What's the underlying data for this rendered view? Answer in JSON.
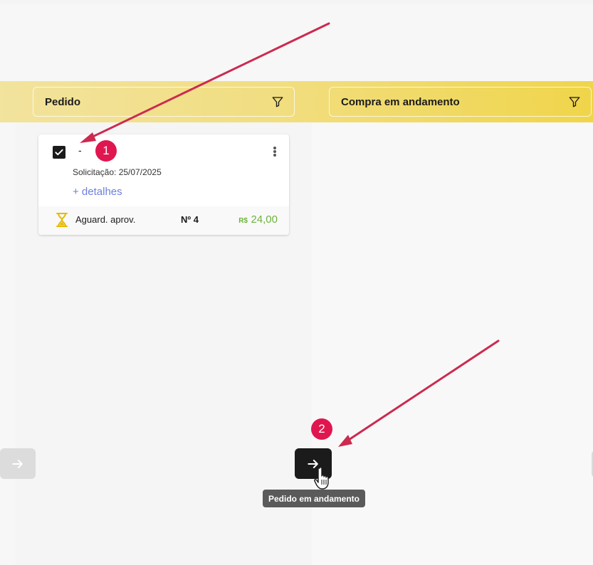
{
  "columns": [
    {
      "title": "Pedido",
      "icon": "filter-icon"
    },
    {
      "title": "Compra em andamento",
      "icon": "filter-icon"
    }
  ],
  "card": {
    "name": "-",
    "checked": true,
    "date": "Solicitação: 25/07/2025",
    "details_link": "+ detalhes",
    "status": "Aguard. aprov.",
    "status_icon": "hourglass-icon",
    "number": "Nº 4",
    "currency": "R$",
    "amount": "24,00"
  },
  "annotations": {
    "step1": "1",
    "step2": "2"
  },
  "navigation": {
    "prev_icon": "arrow-right-icon",
    "next_icon": "arrow-right-icon",
    "tooltip": "Pedido em andamento"
  },
  "colors": {
    "header_band": "#f0d54a",
    "accent_link": "#6d7fe0",
    "price": "#6db33f",
    "badge": "#e0164f",
    "annotation_arrow": "#cc2a4f",
    "status_icon": "#e8b800"
  }
}
